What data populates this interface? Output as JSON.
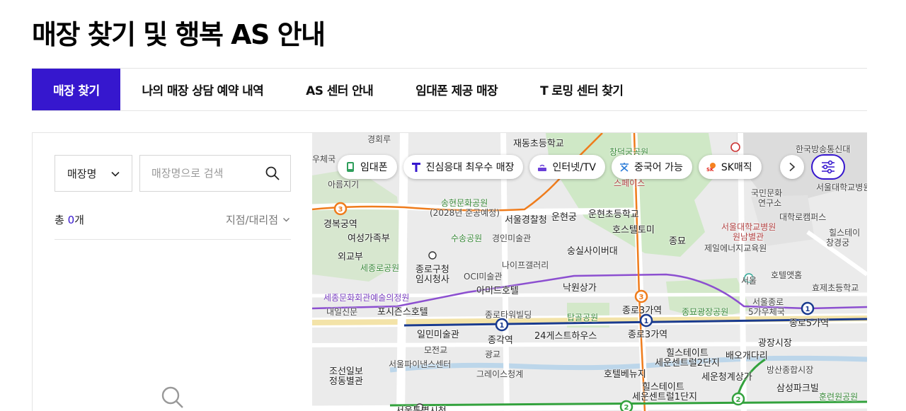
{
  "page": {
    "title": "매장 찾기 및 행복 AS 안내"
  },
  "tabs": [
    {
      "label": "매장 찾기"
    },
    {
      "label": "나의 매장 상담 예약 내역"
    },
    {
      "label": "AS 센터 안내"
    },
    {
      "label": "임대폰 제공 매장"
    },
    {
      "label": "T 로밍 센터 찾기"
    }
  ],
  "search": {
    "select_value": "매장명",
    "placeholder": "매장명으로 검색"
  },
  "results": {
    "count_prefix": "총 ",
    "count": "0",
    "count_suffix": "개",
    "filter_label": "지점/대리점"
  },
  "map": {
    "chips": [
      {
        "label": "임대폰",
        "icon": "phone-icon"
      },
      {
        "label": "진심응대 최우수 매장",
        "icon": "t-logo-icon"
      },
      {
        "label": "인터넷/TV",
        "icon": "router-icon"
      },
      {
        "label": "중국어 가능",
        "icon": "chinese-char-icon"
      },
      {
        "label": "SK매직",
        "icon": "sk-logo-icon"
      }
    ],
    "labels": {
      "l1": "경회루",
      "l2": "재동초등학교",
      "l3": "창덕궁공원",
      "l4": "한국방송통신대",
      "l5": "우체국",
      "l6": "아름지기",
      "l7": "스페이스",
      "l8": "국민문화",
      "l9": "서울대학교병원",
      "l10": "송현문화공원",
      "l11": "(2028년 준공예정)",
      "l12": "서울경찰청",
      "l13": "운현궁",
      "l14": "운현초등학교",
      "l15": "경복궁역",
      "l16": "여성가족부",
      "l17": "수송공원",
      "l18": "경인미술관",
      "l19": "호스텔토미",
      "l20": "종묘",
      "l21": "서울대학교병원",
      "l22": "원남별관",
      "l23": "제일에너지교육원",
      "l24": "힐스테이",
      "l25": "외교부",
      "l26": "숭실사이버대",
      "l27": "세종로공원",
      "l28": "종로구청",
      "l29": "임시청사",
      "l30": "나이프갤러리",
      "l31": "OCI미술관",
      "l32": "호텔앳홈",
      "l33": "효제초등학교",
      "l34": "세종문화회관예술의정원",
      "l35": "아미드호텔",
      "l36": "낙원상가",
      "l37": "내일신문",
      "l38": "포시즌스호텔",
      "l39": "종로3가역",
      "l40": "종묘광장공원",
      "l41": "서울종로",
      "l42": "5가우체국",
      "l43": "종로5가역",
      "l44": "종로타워빌딩",
      "l45": "탑골공원",
      "l46": "종로3가역",
      "l47": "일민미술관",
      "l48": "종각역",
      "l49": "24게스트하우스",
      "l50": "광장시장",
      "l51": "모전교",
      "l52": "광교",
      "l53": "힐스테이트",
      "l54": "세운센트럴2단지",
      "l55": "배오개다리",
      "l56": "서울파이낸스센터",
      "l57": "조선일보",
      "l58": "정동별관",
      "l59": "그레이스청계",
      "l60": "호텔베뉴지",
      "l61": "세운청계상가",
      "l62": "방산종합시장",
      "l63": "삼성파크빌",
      "l64": "힐스테이트",
      "l65": "세운센트럴1단지",
      "l66": "서울특별시청",
      "l67": "창경궁",
      "l68": "연구소",
      "l69": "대학로캠퍼스",
      "l70": "서울",
      "l71": "훈련원공원"
    }
  },
  "colors": {
    "accent": "#3617ce",
    "line1": "#1a3b8f",
    "line3": "#ef7c1c",
    "line5": "#8c4fd0",
    "line2": "#33a23d"
  }
}
